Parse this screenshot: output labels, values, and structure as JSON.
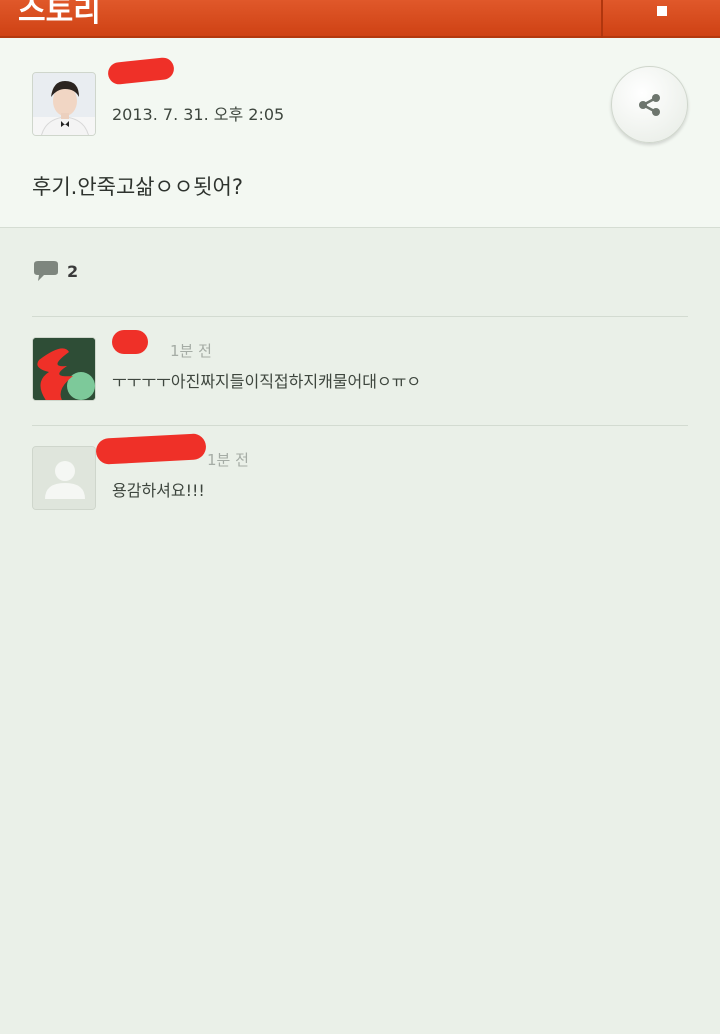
{
  "topbar": {
    "title": "스토리"
  },
  "post": {
    "date": "2013. 7. 31. 오후 2:05",
    "content": "후기.안죽고삶ㅇㅇ됫어?"
  },
  "comments_count": "2",
  "comments": [
    {
      "time": "1분 전",
      "text": "ㅜㅜㅜㅜ아진짜지들이직접하지캐물어대ㅇㅠㅇ"
    },
    {
      "time": "1분 전",
      "text": "용감하셔요!!!"
    }
  ],
  "colors": {
    "topbar": "#d84a1b",
    "redaction": "#ef3028",
    "background": "#eaf0e8"
  }
}
